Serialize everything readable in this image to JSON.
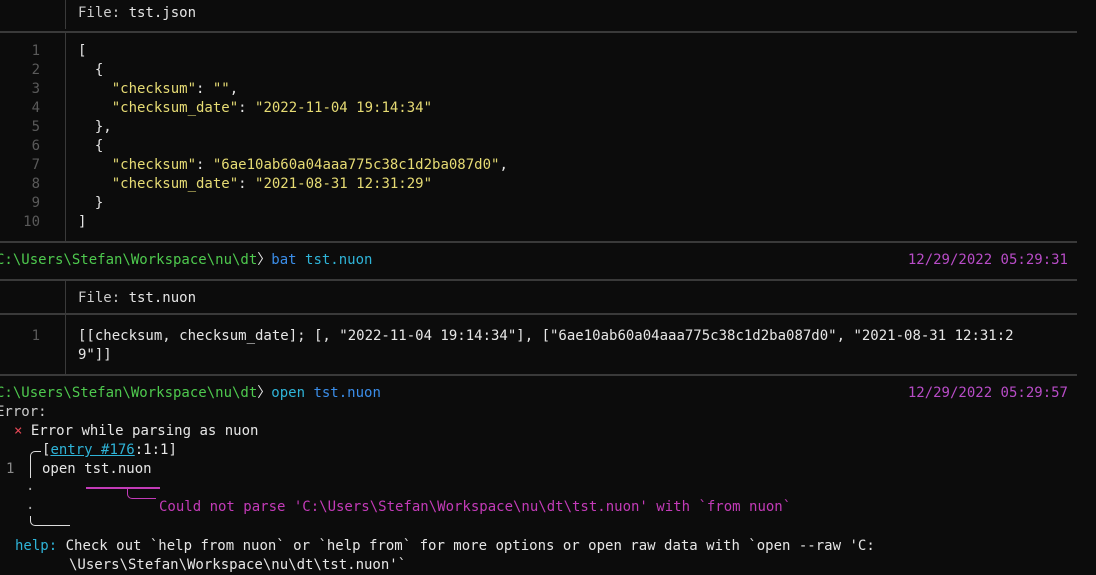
{
  "block1": {
    "file_label": "File: ",
    "file_name": "tst.json",
    "lines": [
      {
        "num": "1",
        "parts": [
          {
            "t": "[",
            "c": "w"
          }
        ]
      },
      {
        "num": "2",
        "parts": [
          {
            "t": "  {",
            "c": "w"
          }
        ]
      },
      {
        "num": "3",
        "parts": [
          {
            "t": "    ",
            "c": "w"
          },
          {
            "t": "\"checksum\"",
            "c": "str"
          },
          {
            "t": ": ",
            "c": "w"
          },
          {
            "t": "\"\"",
            "c": "str"
          },
          {
            "t": ",",
            "c": "w"
          }
        ]
      },
      {
        "num": "4",
        "parts": [
          {
            "t": "    ",
            "c": "w"
          },
          {
            "t": "\"checksum_date\"",
            "c": "str"
          },
          {
            "t": ": ",
            "c": "w"
          },
          {
            "t": "\"2022-11-04 19:14:34\"",
            "c": "str"
          }
        ]
      },
      {
        "num": "5",
        "parts": [
          {
            "t": "  },",
            "c": "w"
          }
        ]
      },
      {
        "num": "6",
        "parts": [
          {
            "t": "  {",
            "c": "w"
          }
        ]
      },
      {
        "num": "7",
        "parts": [
          {
            "t": "    ",
            "c": "w"
          },
          {
            "t": "\"checksum\"",
            "c": "str"
          },
          {
            "t": ": ",
            "c": "w"
          },
          {
            "t": "\"6ae10ab60a04aaa775c38c1d2ba087d0\"",
            "c": "str"
          },
          {
            "t": ",",
            "c": "w"
          }
        ]
      },
      {
        "num": "8",
        "parts": [
          {
            "t": "    ",
            "c": "w"
          },
          {
            "t": "\"checksum_date\"",
            "c": "str"
          },
          {
            "t": ": ",
            "c": "w"
          },
          {
            "t": "\"2021-08-31 12:31:29\"",
            "c": "str"
          }
        ]
      },
      {
        "num": "9",
        "parts": [
          {
            "t": "  }",
            "c": "w"
          }
        ]
      },
      {
        "num": "10",
        "parts": [
          {
            "t": "]",
            "c": "w"
          }
        ]
      }
    ]
  },
  "prompt1": {
    "path": "C:\\Users\\Stefan\\Workspace\\nu\\dt",
    "sep": "〉",
    "cmd": "bat",
    "arg": " tst.nuon",
    "time": "12/29/2022 05:29:31"
  },
  "block2": {
    "file_label": "File: ",
    "file_name": "tst.nuon",
    "line_num": "1",
    "line_a": "[[checksum, checksum_date]; [, \"2022-11-04 19:14:34\"], [\"6ae10ab60a04aaa775c38c1d2ba087d0\", \"2021-08-31 12:31:2",
    "line_b": "9\"]]"
  },
  "prompt2": {
    "path": "C:\\Users\\Stefan\\Workspace\\nu\\dt",
    "sep": "〉",
    "cmd": "open",
    "arg": " tst.nuon",
    "time": "12/29/2022 05:29:57"
  },
  "error": {
    "title": "Error:",
    "x_mark": "×",
    "message": " Error while parsing as nuon",
    "entry_open": "[",
    "entry_link": "entry #176",
    "entry_rest": ":1:1]",
    "src_line_num": "1",
    "src_line": "open tst.nuon",
    "dot": ".",
    "label": "Could not parse 'C:\\Users\\Stefan\\Workspace\\nu\\dt\\tst.nuon' with `from nuon`",
    "help_key": "help:",
    "help_line_a": " Check out `help from nuon` or `help from` for more options or open raw data with `open --raw 'C:",
    "help_line_b": "\\Users\\Stefan\\Workspace\\nu\\dt\\tst.nuon'`"
  }
}
